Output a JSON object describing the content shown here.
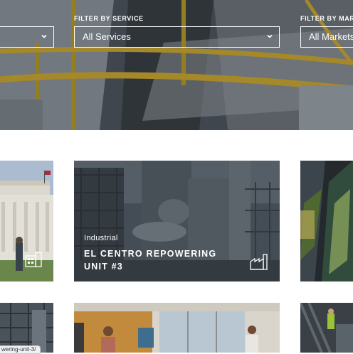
{
  "filters": [
    {
      "label": "",
      "selected": ""
    },
    {
      "label": "FILTER BY SERVICE",
      "selected": "All Services"
    },
    {
      "label": "FILTER BY MARKET",
      "selected": "All Markets"
    }
  ],
  "projects": [
    {
      "category": "Industrial",
      "title": "EL CENTRO REPOWERING UNIT #3",
      "icon": "factory-icon"
    }
  ],
  "status_url": "wering-unit-3/"
}
